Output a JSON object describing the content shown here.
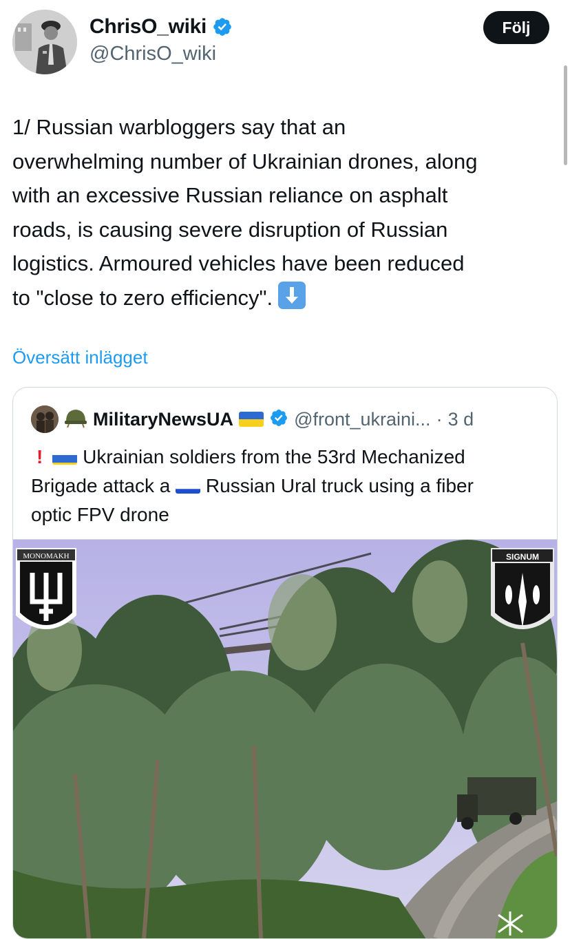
{
  "author": {
    "display_name": "ChrisO_wiki",
    "handle": "@ChrisO_wiki",
    "follow_label": "Följ"
  },
  "tweet": {
    "text": "1/ Russian warbloggers say that an\noverwhelming number of Ukrainian drones, along\nwith an excessive Russian reliance on asphalt\nroads, is causing severe disruption of Russian\nlogistics. Armoured vehicles have been reduced\nto \"close to zero efficiency\".",
    "translate_label": "Översätt inlägget"
  },
  "quote": {
    "name": "MilitaryNewsUA",
    "handle": "@front_ukraini...",
    "separator": "·",
    "time": "3 d",
    "line1": "Ukrainian soldiers from the 53rd Mechanized",
    "line2a": "Brigade attack a",
    "line2b": "Russian Ural truck using a fiber",
    "line3": "optic FPV drone",
    "media": {
      "left_badge_text": "MONOMAKH",
      "right_badge_text": "SIGNUM"
    }
  },
  "colors": {
    "accent": "#1d9bf0",
    "text": "#0f1419",
    "secondary": "#536471",
    "border": "#cfd9de"
  },
  "icons": [
    "verified-badge-icon",
    "down-arrow-emoji-icon",
    "helmet-emoji-icon",
    "exclamation-emoji-icon",
    "ukraine-flag-icon",
    "russia-flag-icon"
  ]
}
